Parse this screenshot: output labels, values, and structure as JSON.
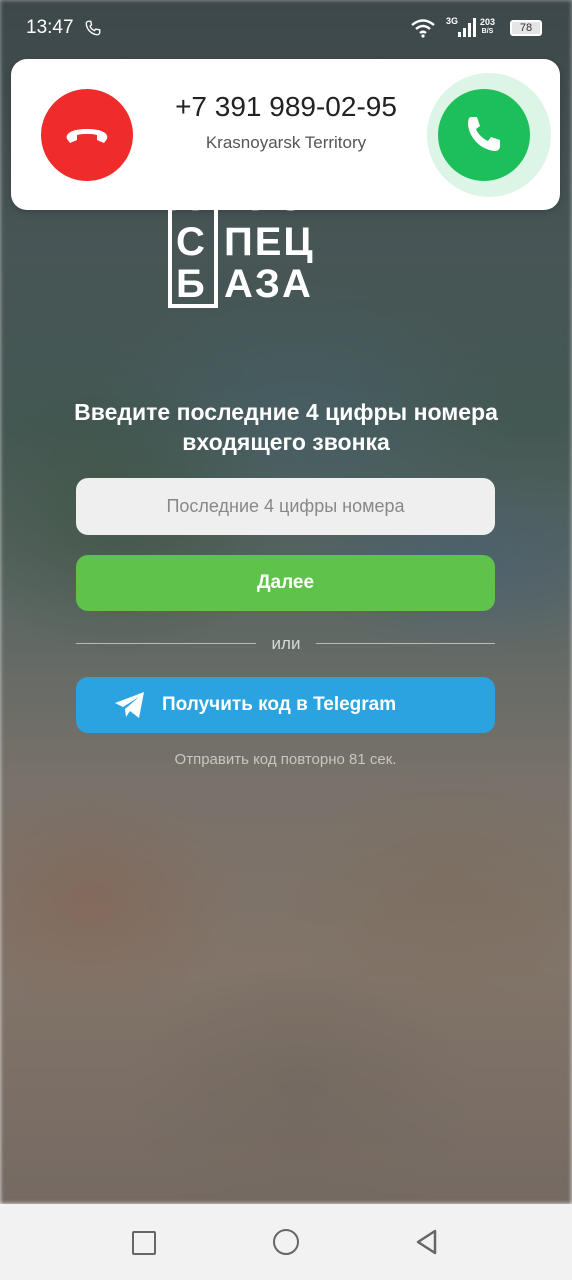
{
  "status_bar": {
    "time": "13:47",
    "network": "3G",
    "speed_value": "203",
    "speed_unit": "B/S",
    "battery": "78"
  },
  "incoming_call": {
    "number": "+7 391 989-02-95",
    "region": "Krasnoyarsk Territory",
    "decline_color": "#ef2b2b",
    "accept_color": "#1dbf5a"
  },
  "logo": {
    "box_line1": "С",
    "box_line2": "Б",
    "word1": "ПЕЦ",
    "word2": "АЗА",
    "top_partial": "АВТО"
  },
  "form": {
    "prompt": "Введите последние 4 цифры номера входящего звонка",
    "code_placeholder": "Последние 4 цифры номера",
    "code_value": "",
    "next_button": "Далее",
    "or_text": "или",
    "telegram_button": "Получить код в Telegram",
    "resend_text": "Отправить код повторно 81 сек."
  },
  "colors": {
    "next_button": "#5fc24a",
    "telegram_button": "#2ba3e0"
  }
}
